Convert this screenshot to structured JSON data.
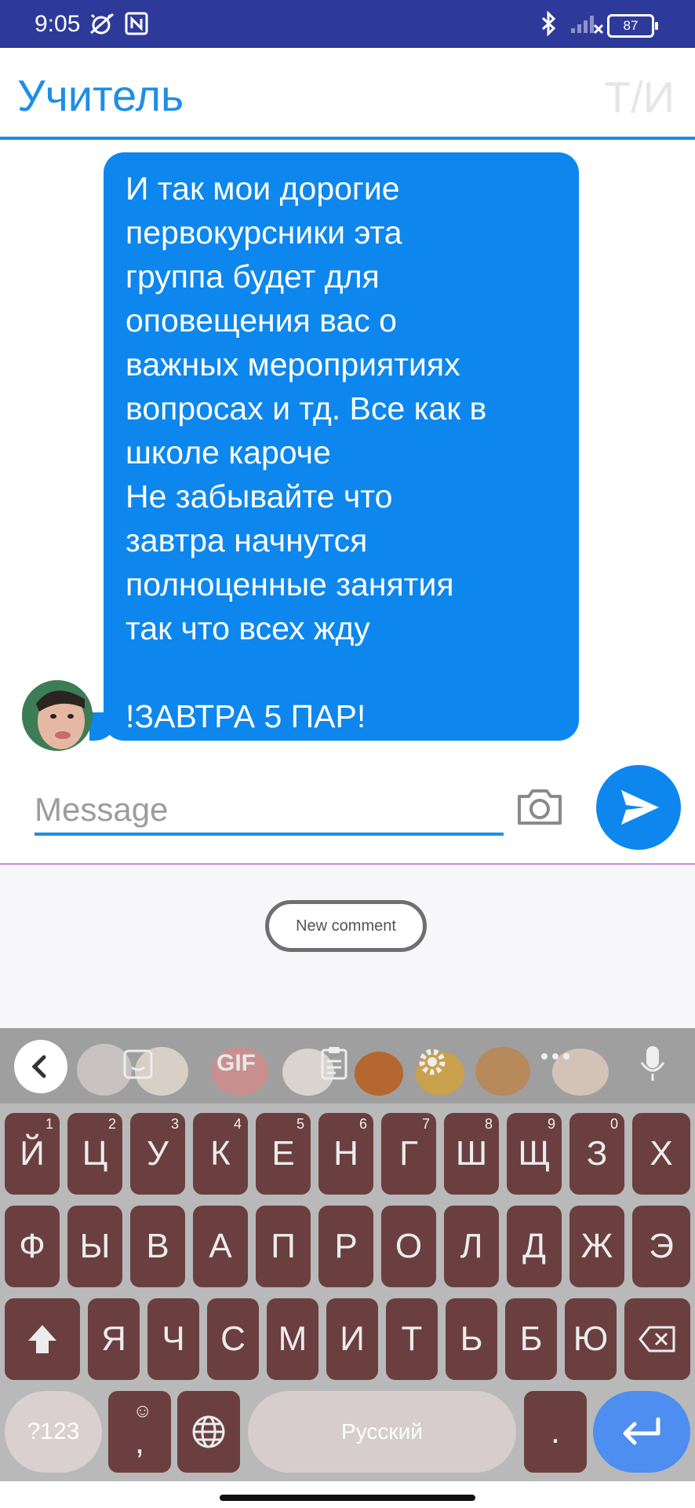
{
  "status_bar": {
    "time": "9:05",
    "battery": "87",
    "icons": [
      "alarm-off-icon",
      "nfc-icon",
      "bluetooth-icon",
      "signal-off-icon",
      "battery-icon"
    ]
  },
  "header": {
    "title": "Учитель",
    "initials": "Т/И"
  },
  "chat": {
    "message": "И так мои дорогие\nпервокурсники эта\nгруппа будет для\nоповещения вас о\nважных мероприятиях\nвопросах и тд. Все как в\nшколе кароче\nНе забывайте что\nзавтра начнутся\nполноценные занятия\nтак что всех жду\n\n!ЗАВТРА 5 ПАР!"
  },
  "composer": {
    "placeholder": "Message",
    "camera_icon": "camera-icon",
    "send_icon": "send-icon"
  },
  "new_comment": {
    "label": "New comment"
  },
  "keyboard": {
    "toolbar": {
      "gif": "GIF",
      "icons": [
        "chevron-left-icon",
        "sticker-icon",
        "gif-icon",
        "clipboard-icon",
        "gear-icon",
        "more-icon",
        "microphone-icon"
      ]
    },
    "row1": [
      {
        "label": "Й",
        "hint": "1"
      },
      {
        "label": "Ц",
        "hint": "2"
      },
      {
        "label": "У",
        "hint": "3"
      },
      {
        "label": "К",
        "hint": "4"
      },
      {
        "label": "Е",
        "hint": "5"
      },
      {
        "label": "Н",
        "hint": "6"
      },
      {
        "label": "Г",
        "hint": "7"
      },
      {
        "label": "Ш",
        "hint": "8"
      },
      {
        "label": "Щ",
        "hint": "9"
      },
      {
        "label": "З",
        "hint": "0"
      },
      {
        "label": "Х",
        "hint": ""
      }
    ],
    "row2": [
      "Ф",
      "Ы",
      "В",
      "А",
      "П",
      "Р",
      "О",
      "Л",
      "Д",
      "Ж",
      "Э"
    ],
    "row3": [
      "Я",
      "Ч",
      "С",
      "М",
      "И",
      "Т",
      "Ь",
      "Б",
      "Ю"
    ],
    "symbols_key": "?123",
    "comma_key": ",",
    "space_label": "Русский",
    "period_key": ".",
    "colors": {
      "key": "#6b3f3f",
      "enter": "#4d8ef0",
      "background": "#b9b9b9"
    }
  }
}
